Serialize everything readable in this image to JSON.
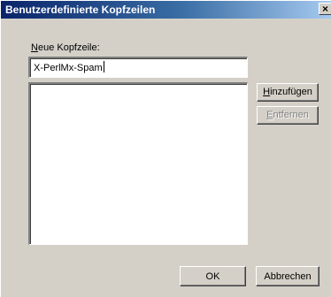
{
  "window": {
    "title": "Benutzerdefinierte Kopfzeilen",
    "close_glyph": "×"
  },
  "form": {
    "label_accesskey": "N",
    "label_rest": "eue Kopfzeile:",
    "input_value": "X-PerlMx-Spam",
    "list_items": []
  },
  "buttons": {
    "add_accesskey": "H",
    "add_rest": "inzufügen",
    "remove_accesskey": "E",
    "remove_rest": "ntfernen",
    "ok": "OK",
    "cancel": "Abbrechen"
  }
}
